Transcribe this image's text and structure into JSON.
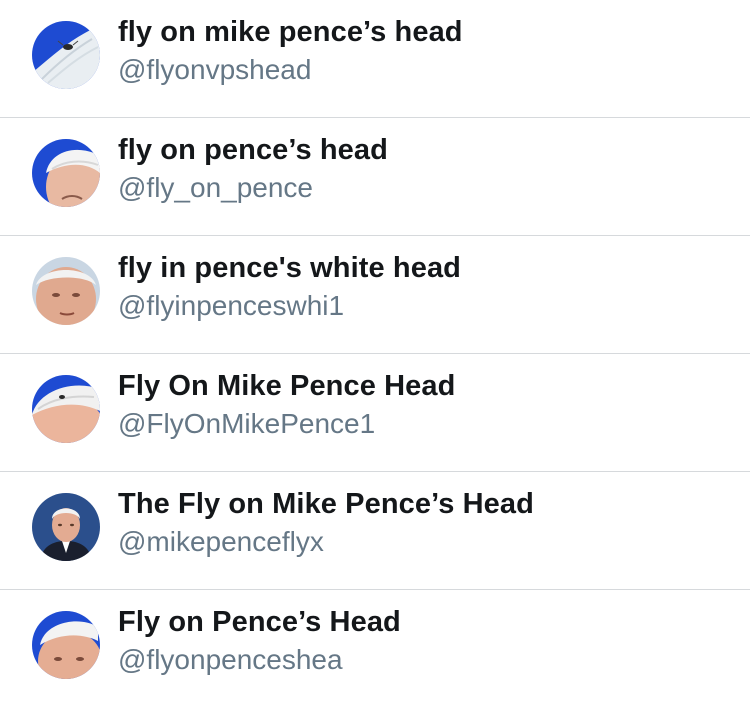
{
  "accounts": [
    {
      "name": "fly on mike pence’s head",
      "handle": "@flyonvpshead",
      "avatar": "pence-hair-fly-closeup-avatar"
    },
    {
      "name": "fly on pence’s head",
      "handle": "@fly_on_pence",
      "avatar": "pence-head-avatar"
    },
    {
      "name": "fly in pence's white head",
      "handle": "@flyinpenceswhi1",
      "avatar": "pence-face-avatar"
    },
    {
      "name": "Fly On Mike Pence Head",
      "handle": "@FlyOnMikePence1",
      "avatar": "pence-hair-fly-avatar"
    },
    {
      "name": "The Fly on Mike Pence’s Head",
      "handle": "@mikepenceflyx",
      "avatar": "pence-portrait-avatar"
    },
    {
      "name": "Fly on Pence’s Head",
      "handle": "@flyonpenceshea",
      "avatar": "pence-head-avatar"
    }
  ],
  "colors": {
    "name_text": "#14171a",
    "handle_text": "#657786",
    "divider": "#d6d9dc",
    "avatar_blue": "#1e4bd2"
  }
}
